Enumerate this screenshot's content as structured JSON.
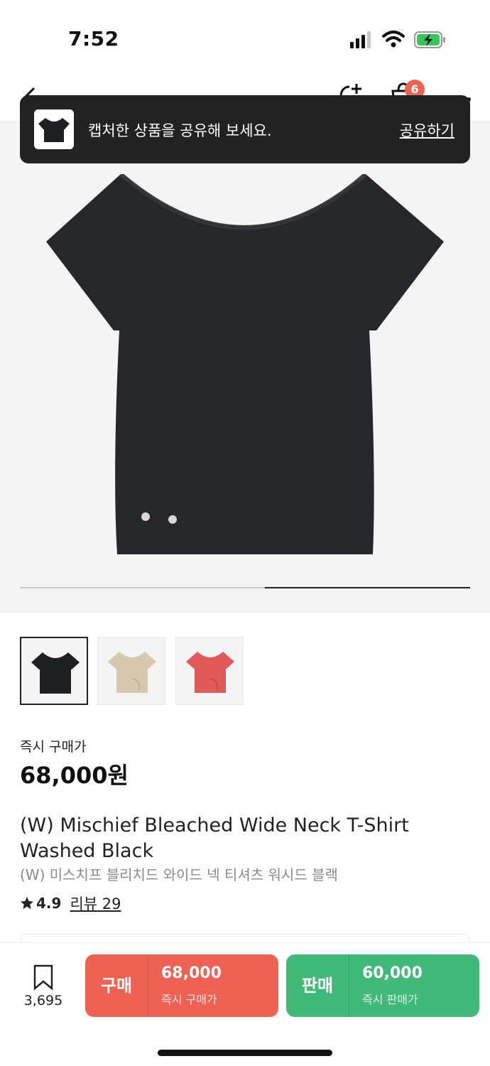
{
  "status_bar": {
    "time": "7:52",
    "icons": [
      "signal-icon",
      "wifi-icon",
      "battery-charging-icon"
    ]
  },
  "nav": {
    "back_icon": "arrow-left-icon",
    "share_icon": "share-plus-icon",
    "cart_icon": "cart-icon",
    "cart_badge": "6",
    "more_icon": "more-icon"
  },
  "toast": {
    "message": "캡처한 상품을 공유해 보세요.",
    "action": "공유하기"
  },
  "product": {
    "price_label": "즉시 구매가",
    "price": "68,000원",
    "title_en": "(W) Mischief Bleached Wide Neck T-Shirt Washed Black",
    "title_ko": "(W) 미스치프 블리치드 와이드 넥 티셔츠 워시드 블랙",
    "rating": "4.9",
    "reviews": "리뷰 29",
    "image_slide_progress": 0.5,
    "thumbnails": [
      {
        "name": "black",
        "color": "#1e1f22",
        "selected": true
      },
      {
        "name": "beige",
        "color": "#d9c8b0",
        "selected": false
      },
      {
        "name": "red",
        "color": "#e05a5a",
        "selected": false
      }
    ]
  },
  "bottom_bar": {
    "bookmark_count": "3,695",
    "buy": {
      "label": "구매",
      "price": "68,000",
      "sub": "즉시 구매가",
      "color": "#ef6253"
    },
    "sell": {
      "label": "판매",
      "price": "60,000",
      "sub": "즉시 판매가",
      "color": "#41b979"
    }
  }
}
